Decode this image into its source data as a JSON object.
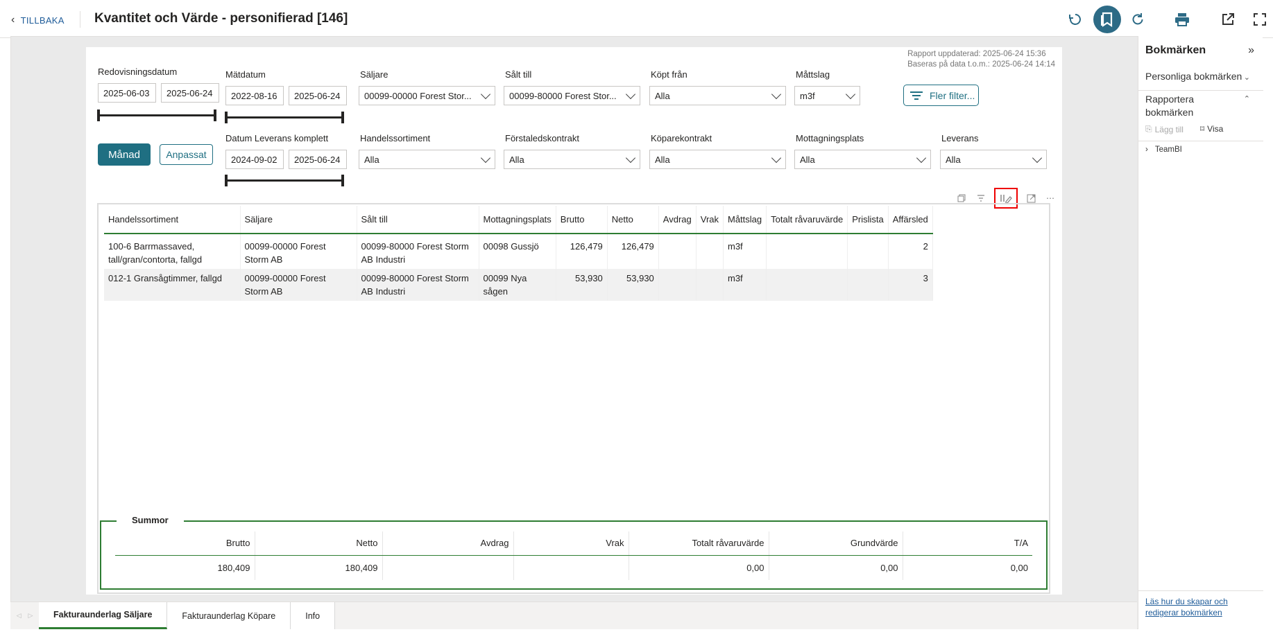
{
  "topbar": {
    "back_label": "TILLBAKA",
    "title": "Kvantitet och Värde - personifierad [146]"
  },
  "meta": {
    "updated": "Rapport uppdaterad: 2025-06-24 15:36",
    "based_on": "Baseras på data t.o.m.: 2025-06-24 14:14"
  },
  "filters": {
    "redovisningsdatum": {
      "label": "Redovisningsdatum",
      "from": "2025-06-03",
      "to": "2025-06-24"
    },
    "matdatum": {
      "label": "Mätdatum",
      "from": "2022-08-16",
      "to": "2025-06-24"
    },
    "leverans_komplett": {
      "label": "Datum Leverans komplett",
      "from": "2024-09-02",
      "to": "2025-06-24"
    },
    "saljare": {
      "label": "Säljare",
      "value": "00099-00000 Forest Stor..."
    },
    "salt_till": {
      "label": "Sålt till",
      "value": "00099-80000 Forest Stor..."
    },
    "kopt_fran": {
      "label": "Köpt från",
      "value": "Alla"
    },
    "mattslag": {
      "label": "Måttslag",
      "value": "m3f"
    },
    "handelssortiment": {
      "label": "Handelssortiment",
      "value": "Alla"
    },
    "forstaledskontrakt": {
      "label": "Förstaledskontrakt",
      "value": "Alla"
    },
    "koparekontrakt": {
      "label": "Köparekontrakt",
      "value": "Alla"
    },
    "mottagningsplats": {
      "label": "Mottagningsplats",
      "value": "Alla"
    },
    "leverans": {
      "label": "Leverans",
      "value": "Alla"
    },
    "manad_label": "Månad",
    "anpassat_label": "Anpassat",
    "fler_filter_label": "Fler filter..."
  },
  "table": {
    "columns": [
      "Handelssortiment",
      "Säljare",
      "Sålt till",
      "Mottagningsplats",
      "Brutto",
      "Netto",
      "Avdrag",
      "Vrak",
      "Måttslag",
      "Totalt råvaruvärde",
      "Prislista",
      "Affärsled"
    ],
    "rows": [
      [
        "100-6 Barrmassaved, tall/gran/contorta, fallgd",
        "00099-00000 Forest Storm AB",
        "00099-80000 Forest Storm AB Industri",
        "00098 Gussjö",
        "126,479",
        "126,479",
        "",
        "",
        "m3f",
        "",
        "",
        "2"
      ],
      [
        "012-1 Gransågtimmer, fallgd",
        "00099-00000 Forest Storm AB",
        "00099-80000 Forest Storm AB Industri",
        "00099 Nya sågen",
        "53,930",
        "53,930",
        "",
        "",
        "m3f",
        "",
        "",
        "3"
      ]
    ]
  },
  "summor": {
    "title": "Summor",
    "columns": [
      "Brutto",
      "Netto",
      "Avdrag",
      "Vrak",
      "Totalt råvaruvärde",
      "Grundvärde",
      "T/A"
    ],
    "values": [
      "180,409",
      "180,409",
      "",
      "",
      "0,00",
      "0,00",
      "0,00"
    ]
  },
  "tabs": [
    "Fakturaunderlag Säljare",
    "Fakturaunderlag Köpare",
    "Info"
  ],
  "bookmarks": {
    "title": "Bokmärken",
    "personal": "Personliga bokmärken",
    "report": "Rapportera bokmärken",
    "add": "Lägg till",
    "view": "Visa",
    "group": "TeamBI",
    "help_link": "Läs hur du skapar och redigerar bokmärken"
  }
}
